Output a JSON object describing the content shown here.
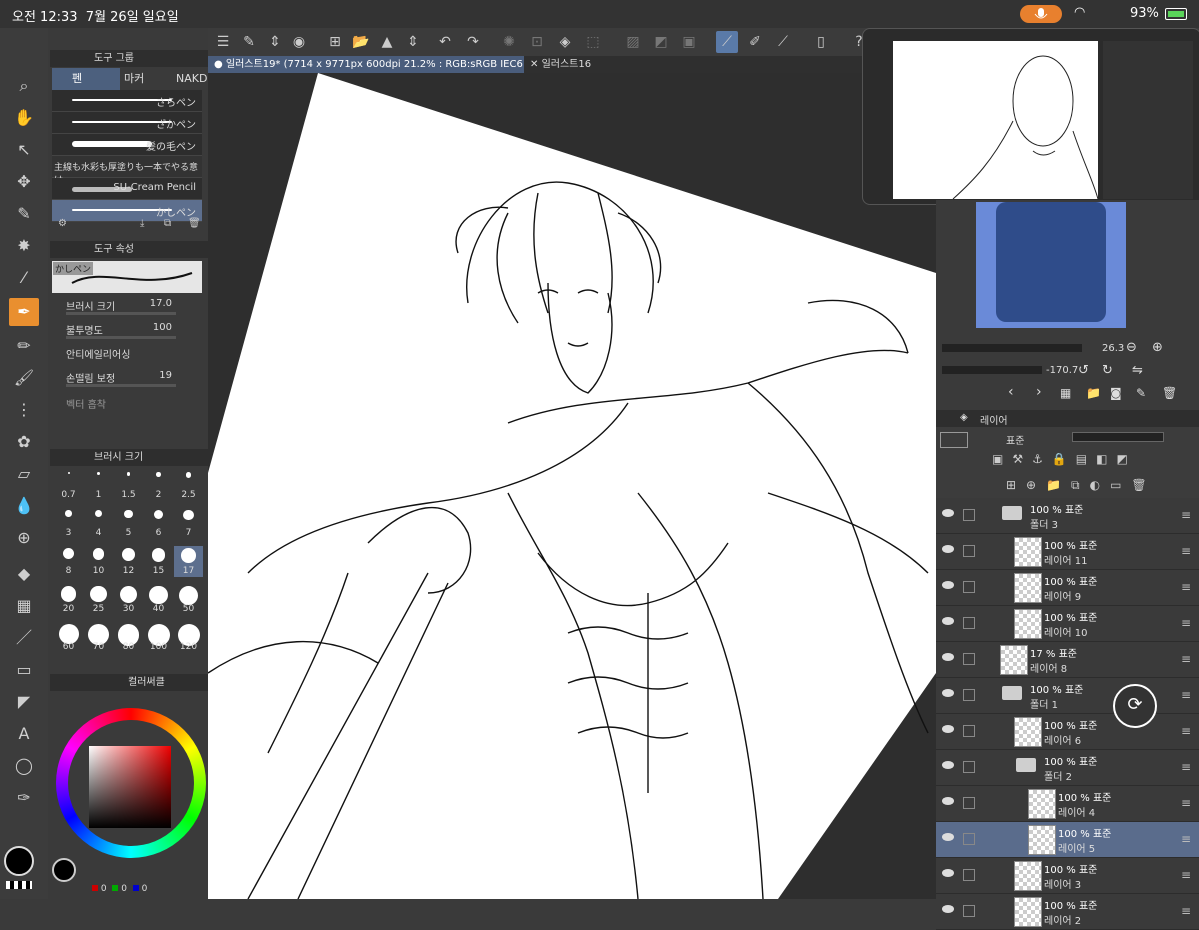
{
  "status": {
    "time": "오전 12:33",
    "date": "7월 26일 일요일",
    "battery": "93%"
  },
  "tabs": [
    {
      "label": "일러스트19* (7714 x 9771px 600dpi 21.2% : RGB:sRGB IEC61966-2.1)"
    },
    {
      "label": "일러스트16"
    }
  ],
  "left_panel": {
    "tool_group_title": "도구 그룹",
    "subtools": [
      "펜",
      "마커",
      "NAKD"
    ],
    "brushes": [
      "さらペン",
      "ざかペン",
      "髪の毛ペン",
      "主線も水彩も厚塗りも一本でやる意け",
      "SU-Cream Pencil",
      "かしペン"
    ],
    "tool_property_title": "도구 속성",
    "preview_name": "かしペン",
    "props": [
      {
        "label": "브러시 크기",
        "value": "17.0"
      },
      {
        "label": "불투명도",
        "value": "100"
      },
      {
        "label": "안티에일리어싱",
        "value": ""
      },
      {
        "label": "손떨림 보정",
        "value": "19"
      },
      {
        "label": "벡터 흡착",
        "value": ""
      }
    ],
    "brush_size_title": "브러시 크기",
    "sizes": [
      "0.7",
      "1",
      "1.5",
      "2",
      "2.5",
      "3",
      "4",
      "5",
      "6",
      "7",
      "8",
      "10",
      "12",
      "15",
      "17",
      "20",
      "25",
      "30",
      "40",
      "50",
      "60",
      "70",
      "80",
      "100",
      "120"
    ],
    "active_size": "17",
    "color_circle_title": "컬러써클",
    "rgb": [
      "0",
      "0",
      "0"
    ]
  },
  "layers": {
    "title": "레이어",
    "blend_mode": "표준",
    "rows": [
      {
        "pct": "100 % 표준",
        "name": "폴더 3",
        "type": "folder",
        "indent": 0
      },
      {
        "pct": "100 % 표준",
        "name": "레이어 11",
        "type": "layer",
        "indent": 1
      },
      {
        "pct": "100 % 표준",
        "name": "레이어 9",
        "type": "layer",
        "indent": 1
      },
      {
        "pct": "100 % 표준",
        "name": "레이어 10",
        "type": "layer",
        "indent": 1
      },
      {
        "pct": "17 % 표준",
        "name": "레이어 8",
        "type": "layer",
        "indent": 0
      },
      {
        "pct": "100 % 표준",
        "name": "폴더 1",
        "type": "folder",
        "indent": 0
      },
      {
        "pct": "100 % 표준",
        "name": "레이어 6",
        "type": "layer",
        "indent": 1
      },
      {
        "pct": "100 % 표준",
        "name": "폴더 2",
        "type": "folder",
        "indent": 1
      },
      {
        "pct": "100 % 표준",
        "name": "레이어 4",
        "type": "layer",
        "indent": 2
      },
      {
        "pct": "100 % 표준",
        "name": "레이어 5",
        "type": "layer",
        "indent": 2,
        "active": true
      },
      {
        "pct": "100 % 표준",
        "name": "레이어 3",
        "type": "layer",
        "indent": 1
      },
      {
        "pct": "100 % 표준",
        "name": "레이어 2",
        "type": "layer",
        "indent": 1
      }
    ]
  },
  "navigator": {
    "zoom": "26.3",
    "rotation": "-170.7"
  },
  "colors": {
    "accent": "#e98f2f",
    "selection": "#5a6c8c",
    "mic": "#e8802e"
  }
}
